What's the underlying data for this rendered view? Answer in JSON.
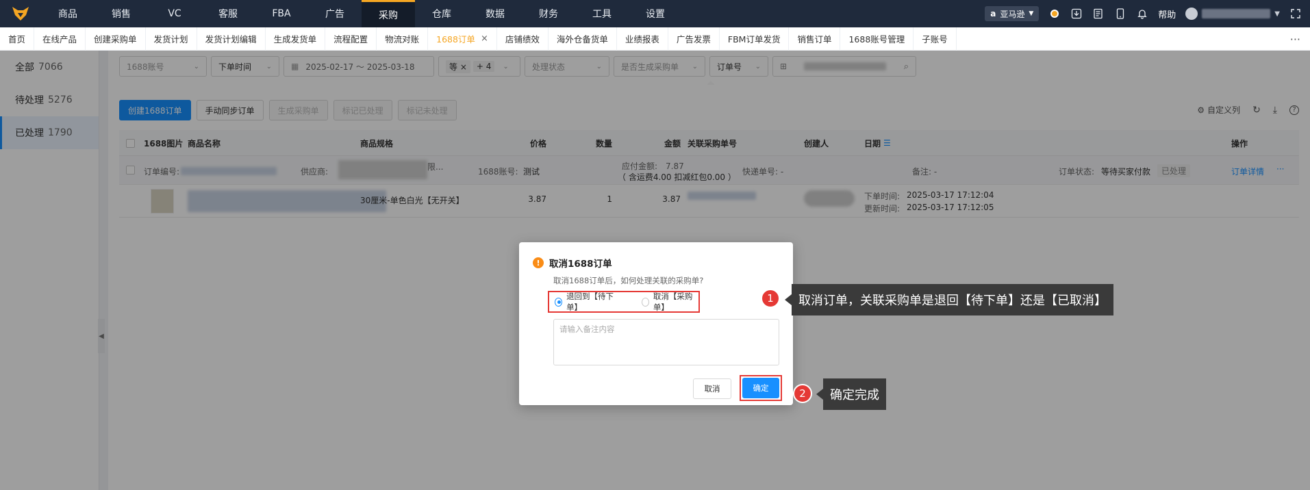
{
  "topnav": {
    "items": [
      "商品",
      "销售",
      "VC",
      "客服",
      "FBA",
      "广告",
      "采购",
      "仓库",
      "数据",
      "财务",
      "工具",
      "设置"
    ],
    "active_index": 6,
    "marketplace": "亚马逊",
    "help": "帮助"
  },
  "tabs": {
    "items": [
      "首页",
      "在线产品",
      "创建采购单",
      "发货计划",
      "发货计划编辑",
      "生成发货单",
      "流程配置",
      "物流对账",
      "1688订单",
      "店铺绩效",
      "海外仓备货单",
      "业绩报表",
      "广告发票",
      "FBM订单发货",
      "销售订单",
      "1688账号管理",
      "子账号"
    ],
    "active_index": 8,
    "more": "···"
  },
  "left_filter": {
    "items": [
      {
        "label": "全部",
        "count": "7066"
      },
      {
        "label": "待处理",
        "count": "5276"
      },
      {
        "label": "已处理",
        "count": "1790"
      }
    ],
    "active_index": 2
  },
  "filters": {
    "account_placeholder": "1688账号",
    "time_type": "下单时间",
    "date_range": "2025-02-17 ～ 2025-03-18",
    "tag_chip": "等",
    "tag_more": "+ 4",
    "status_placeholder": "处理状态",
    "generated_placeholder": "是否生成采购单",
    "search_field": "订单号"
  },
  "actions": {
    "create": "创建1688订单",
    "sync": "手动同步订单",
    "generate": "生成采购单",
    "mark_done": "标记已处理",
    "mark_undone": "标记未处理",
    "custom_columns": "自定义列"
  },
  "table": {
    "headers": {
      "image": "1688图片",
      "name": "商品名称",
      "spec": "商品规格",
      "price": "价格",
      "qty": "数量",
      "amount": "金额",
      "po": "关联采购单号",
      "creator": "创建人",
      "date": "日期",
      "ops": "操作"
    },
    "order": {
      "order_no_label": "订单编号:",
      "supplier_label": "供应商:",
      "supplier_tail": "限...",
      "account_label": "1688账号:",
      "account": "测试",
      "payable": "应付金额:　7.87",
      "payable_detail": "（ 含运费4.00 扣减红包0.00 ）",
      "tracking": "快递单号: -",
      "remark": "备注: -",
      "status_label": "订单状态:",
      "status": "等待买家付款",
      "processed": "已处理",
      "detail_link": "订单详情",
      "more": "···"
    },
    "item": {
      "spec": "30厘米-单色白光【无开关】",
      "price": "3.87",
      "qty": "1",
      "amount": "3.87",
      "order_time_label": "下单时间:",
      "order_time": "2025-03-17 17:12:04",
      "update_time_label": "更新时间:",
      "update_time": "2025-03-17 17:12:05"
    }
  },
  "modal": {
    "title": "取消1688订单",
    "desc": "取消1688订单后，如何处理关联的采购单?",
    "option_1": "退回到【待下单】",
    "option_2": "取消【采购单】",
    "selected": 1,
    "remark_placeholder": "请输入备注内容",
    "cancel": "取消",
    "confirm": "确定"
  },
  "callouts": [
    {
      "step": "1",
      "text": "取消订单，关联采购单是退回【待下单】还是【已取消】"
    },
    {
      "step": "2",
      "text": "确定完成"
    }
  ],
  "colors": {
    "nav_bg": "#1f2a3c",
    "accent_orange": "#f5a623",
    "primary_blue": "#1890ff",
    "highlight_red": "#e53935"
  }
}
